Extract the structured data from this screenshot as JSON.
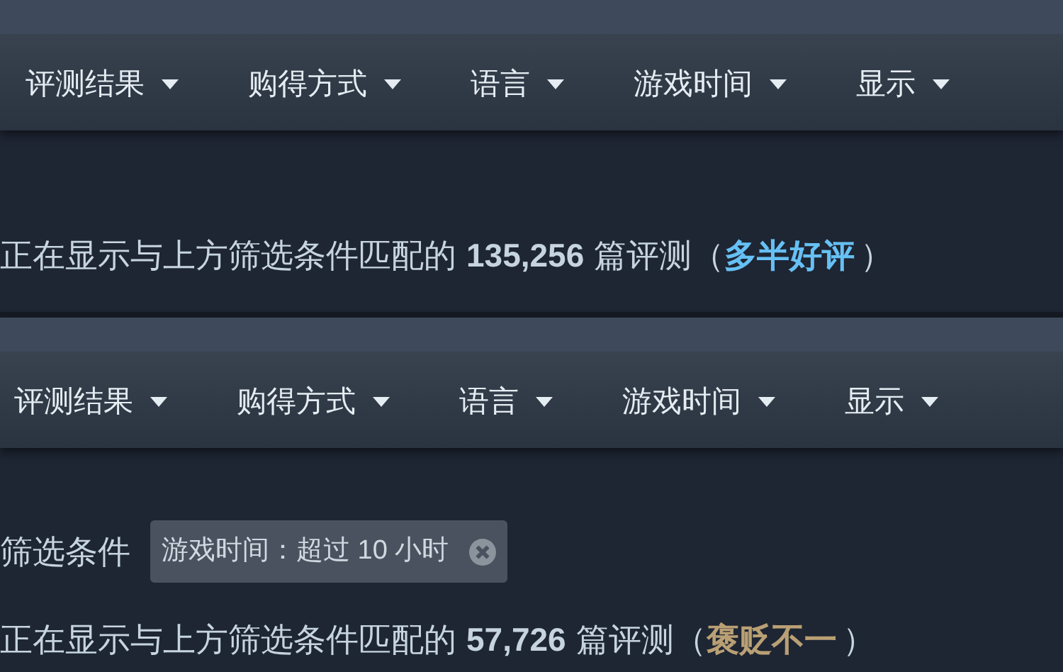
{
  "panels": [
    {
      "menus": [
        {
          "label": "评测结果"
        },
        {
          "label": "购得方式"
        },
        {
          "label": "语言"
        },
        {
          "label": "游戏时间"
        },
        {
          "label": "显示"
        }
      ],
      "summary": {
        "prefix": "正在显示与上方筛选条件匹配的",
        "count": "135,256",
        "suffix": "篇评测",
        "open": "（",
        "rating": {
          "text": "多半好评",
          "color": "#66c0f4"
        },
        "close": "）"
      }
    },
    {
      "menus": [
        {
          "label": "评测结果"
        },
        {
          "label": "购得方式"
        },
        {
          "label": "语言"
        },
        {
          "label": "游戏时间"
        },
        {
          "label": "显示"
        }
      ],
      "filters_label": "筛选条件",
      "filters": [
        {
          "label": "游戏时间：超过 10 小时"
        }
      ],
      "summary": {
        "prefix": "正在显示与上方筛选条件匹配的",
        "count": "57,726",
        "suffix": "篇评测",
        "open": "（",
        "rating": {
          "text": "褒贬不一",
          "color": "#b9a074"
        },
        "close": "）"
      }
    }
  ]
}
